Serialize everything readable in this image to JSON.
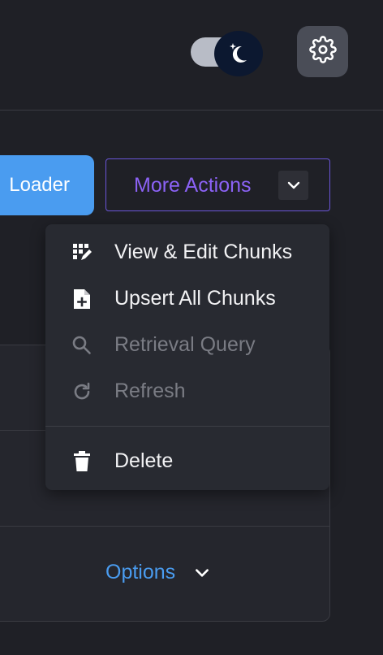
{
  "theme_toggle": {
    "state": "dark"
  },
  "settings": {
    "icon": "gear-icon"
  },
  "actions": {
    "loader_label": "Loader",
    "more_actions_label": "More Actions"
  },
  "menu": {
    "items": [
      {
        "label": "View & Edit Chunks",
        "icon": "edit-grid-icon",
        "enabled": true
      },
      {
        "label": "Upsert All Chunks",
        "icon": "file-plus-icon",
        "enabled": true
      },
      {
        "label": "Retrieval Query",
        "icon": "search-icon",
        "enabled": false
      },
      {
        "label": "Refresh",
        "icon": "refresh-icon",
        "enabled": false
      },
      {
        "label": "Delete",
        "icon": "trash-icon",
        "enabled": true
      }
    ]
  },
  "card": {
    "options_label": "Options"
  },
  "colors": {
    "background": "#1f2026",
    "primary": "#4a9cf0",
    "accent": "#8b62f5",
    "menu_bg": "#282a31"
  }
}
